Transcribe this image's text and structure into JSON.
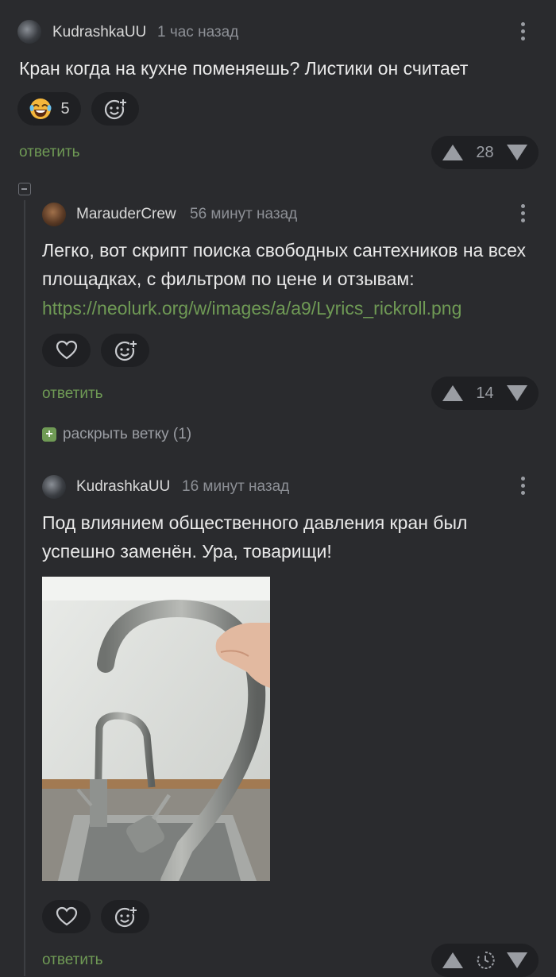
{
  "comments": [
    {
      "author": "KudrashkaUU",
      "time": "1 час назад",
      "text": "Кран когда на кухне поменяешь? Листики он считает",
      "reaction_count": "5",
      "reply_label": "ответить",
      "votes": "28"
    },
    {
      "author": "MarauderCrew",
      "time": "56 минут назад",
      "text": "Легко, вот скрипт поиска свободных сантехников на всех площадках, с фильтром по цене и отзывам:",
      "link": "https://neolurk.org/w/images/a/a9/Lyrics_rickroll.png",
      "reply_label": "ответить",
      "votes": "14"
    },
    {
      "author": "KudrashkaUU",
      "time": "16 минут назад",
      "text": "Под влиянием общественного давления кран был успешно заменён. Ура, товарищи!",
      "reply_label": "ответить"
    }
  ],
  "expand_thread_label": "раскрыть ветку (1)",
  "colors": {
    "background": "#2a2b2e",
    "accent_green": "#6f9a55",
    "pill_bg": "#1f2023"
  },
  "icons": [
    "dots-menu-icon",
    "laugh-emoji-icon",
    "add-reaction-icon",
    "heart-icon",
    "upvote-icon",
    "downvote-icon",
    "collapse-icon",
    "expand-icon",
    "timer-icon"
  ]
}
